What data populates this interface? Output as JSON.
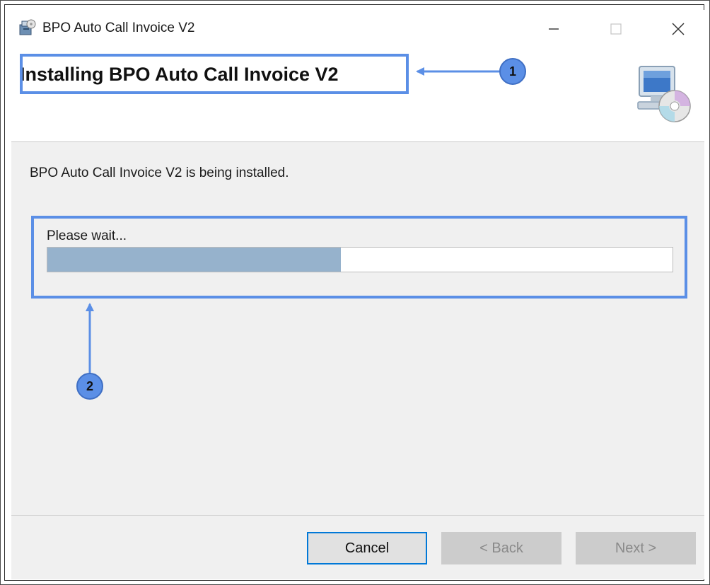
{
  "window": {
    "title": "BPO Auto Call Invoice V2",
    "controls": {
      "minimize": "minimize-icon",
      "maximize": "maximize-icon",
      "close": "close-icon"
    }
  },
  "banner": {
    "title": "Installing BPO Auto Call Invoice V2",
    "icon": "computer-disc-icon"
  },
  "body": {
    "status_text": "BPO Auto Call Invoice V2 is being installed.",
    "wait_label": "Please wait...",
    "progress_fraction": 0.47
  },
  "buttons": {
    "cancel": "Cancel",
    "back": "< Back",
    "next": "Next >"
  },
  "annotations": {
    "badge_1": "1",
    "badge_2": "2",
    "color": "#5b8fe6"
  },
  "colors": {
    "progress_fill": "#96b2cc",
    "focus_border": "#0078d7",
    "window_bg": "#f0f0f0"
  }
}
